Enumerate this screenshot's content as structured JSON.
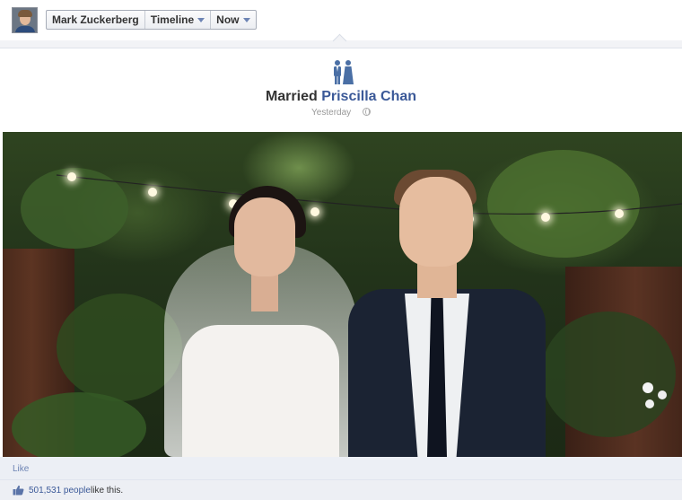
{
  "nav": {
    "profile_name": "Mark Zuckerberg",
    "timeline_label": "Timeline",
    "period_label": "Now"
  },
  "event": {
    "icon": "married-couple-icon",
    "prefix": "Married",
    "partner_name": "Priscilla Chan",
    "time": "Yesterday",
    "privacy_icon": "globe-icon"
  },
  "photo": {
    "subject": "wedding-photo"
  },
  "footer": {
    "like_label": "Like",
    "likes_count": "501,531 people",
    "likes_suffix": "like this."
  },
  "colors": {
    "link": "#3b5998",
    "footer_bg": "#eceff5",
    "icon_blue": "#4a6fa5"
  }
}
